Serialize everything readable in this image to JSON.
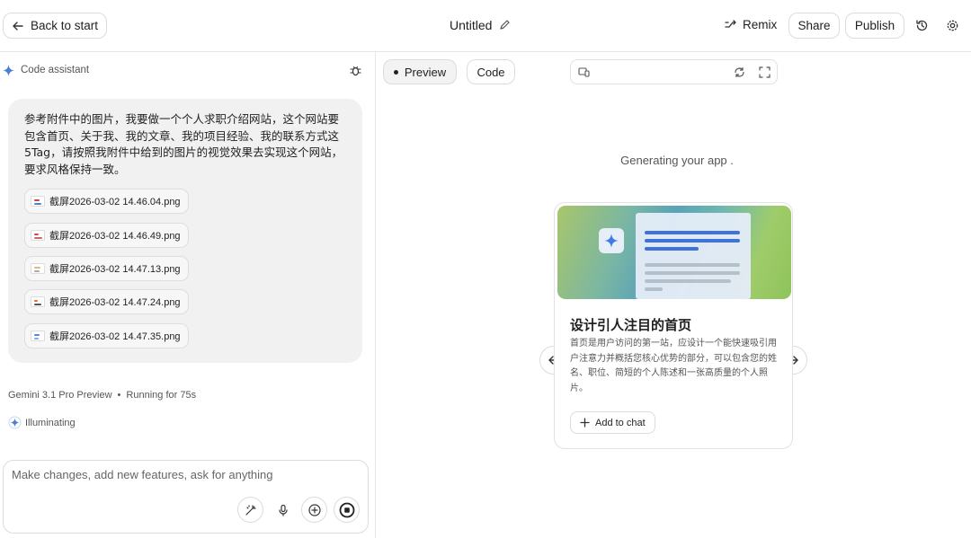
{
  "topbar": {
    "back_label": "Back to start",
    "title": "Untitled",
    "remix_label": "Remix",
    "share_label": "Share",
    "publish_label": "Publish"
  },
  "left_panel": {
    "title": "Code assistant",
    "message": "参考附件中的图片，我要做一个个人求职介绍网站，这个网站要包含首页、关于我、我的文章、我的项目经验、我的联系方式这5Tag，请按照我附件中给到的图片的视觉效果去实现这个网站，要求风格保持一致。",
    "attachments": [
      {
        "name": "截屏2026-03-02 14.46.04.png"
      },
      {
        "name": "截屏2026-03-02 14.46.49.png"
      },
      {
        "name": "截屏2026-03-02 14.47.13.png"
      },
      {
        "name": "截屏2026-03-02 14.47.24.png"
      },
      {
        "name": "截屏2026-03-02 14.47.35.png"
      }
    ],
    "model": "Gemini 3.1 Pro Preview",
    "separator": "•",
    "running": "Running for 75s",
    "illuminating": "Illuminating",
    "input_placeholder": "Make changes, add new features, ask for anything"
  },
  "right_panel": {
    "tabs": [
      {
        "label": "Preview"
      },
      {
        "label": "Code"
      }
    ],
    "generating": "Generating your app .",
    "card": {
      "title": "设计引人注目的首页",
      "description": "首页是用户访问的第一站，应设计一个能快速吸引用户注意力并概括您核心优势的部分，可以包含您的姓名、职位、简短的个人陈述和一张高质量的个人照片。",
      "add_label": "Add to chat"
    }
  },
  "colors": {
    "accent_blue": "#4a7fd6",
    "border": "#dcdcdc",
    "bubble_bg": "#f1f1f1"
  },
  "icons": [
    "arrow-left-icon",
    "pencil-icon",
    "remix-icon",
    "history-icon",
    "gear-icon",
    "sparkle-icon",
    "bug-icon",
    "wand-icon",
    "mic-icon",
    "plus-icon",
    "stop-icon",
    "device-icon",
    "refresh-icon",
    "fullscreen-icon",
    "arrow-right-icon"
  ]
}
